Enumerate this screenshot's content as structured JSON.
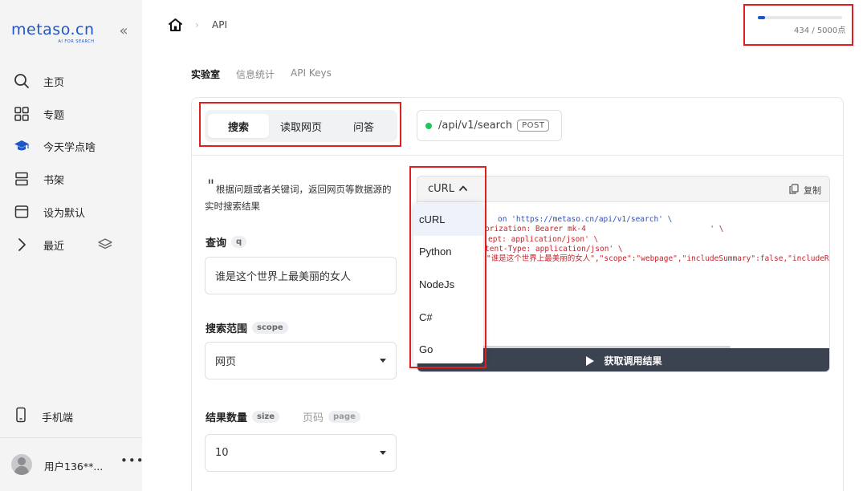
{
  "sidebar": {
    "logo_main": "metaso.cn",
    "logo_sub": "AI FOR SEARCH",
    "items": [
      {
        "label": "主页",
        "icon": "search-icon"
      },
      {
        "label": "专题",
        "icon": "grid-icon"
      },
      {
        "label": "今天学点啥",
        "icon": "graduation-cap-icon"
      },
      {
        "label": "书架",
        "icon": "bookshelf-icon"
      },
      {
        "label": "设为默认",
        "icon": "browser-window-icon"
      },
      {
        "label": "最近",
        "icon": "chevron-right-icon"
      }
    ],
    "mobile": "手机端",
    "user_name": "用户136**..."
  },
  "header": {
    "breadcrumb_current": "API",
    "quota_text": "434 / 5000点",
    "quota_fraction": 0.087
  },
  "top_tabs": [
    "实验室",
    "信息统计",
    "API Keys"
  ],
  "segment": {
    "items": [
      "搜索",
      "读取网页",
      "问答"
    ],
    "active_index": 0
  },
  "endpoint": {
    "path": "/api/v1/search",
    "method": "POST",
    "status_color": "#22c55e"
  },
  "form": {
    "description": "根据问题或者关键词，返回网页等数据源的实时搜索结果",
    "query_label": "查询",
    "query_tag": "q",
    "query_value": "谁是这个世界上最美丽的女人",
    "scope_label": "搜索范围",
    "scope_tag": "scope",
    "scope_value": "网页",
    "size_label": "结果数量",
    "size_tag": "size",
    "page_label": "页码",
    "page_tag": "page",
    "size_value": "10"
  },
  "code": {
    "language": "cURL",
    "copy_label": "复制",
    "lines": [
      "on 'https://metaso.cn/api/v1/search' \\",
      "orization: Bearer mk-4                           ' \\",
      "ept: application/json' \\",
      "tent-Type: application/json' \\",
      "\"谁是这个世界上最美丽的女人\",\"scope\":\"webpage\",\"includeSummary\":false,\"includeR"
    ],
    "run_label": "获取调用结果"
  },
  "dropdown": {
    "options": [
      "cURL",
      "Python",
      "NodeJs",
      "C#",
      "Go"
    ],
    "selected_index": 0
  },
  "accent_color": "#1d56c9",
  "highlight_color": "#e02020"
}
